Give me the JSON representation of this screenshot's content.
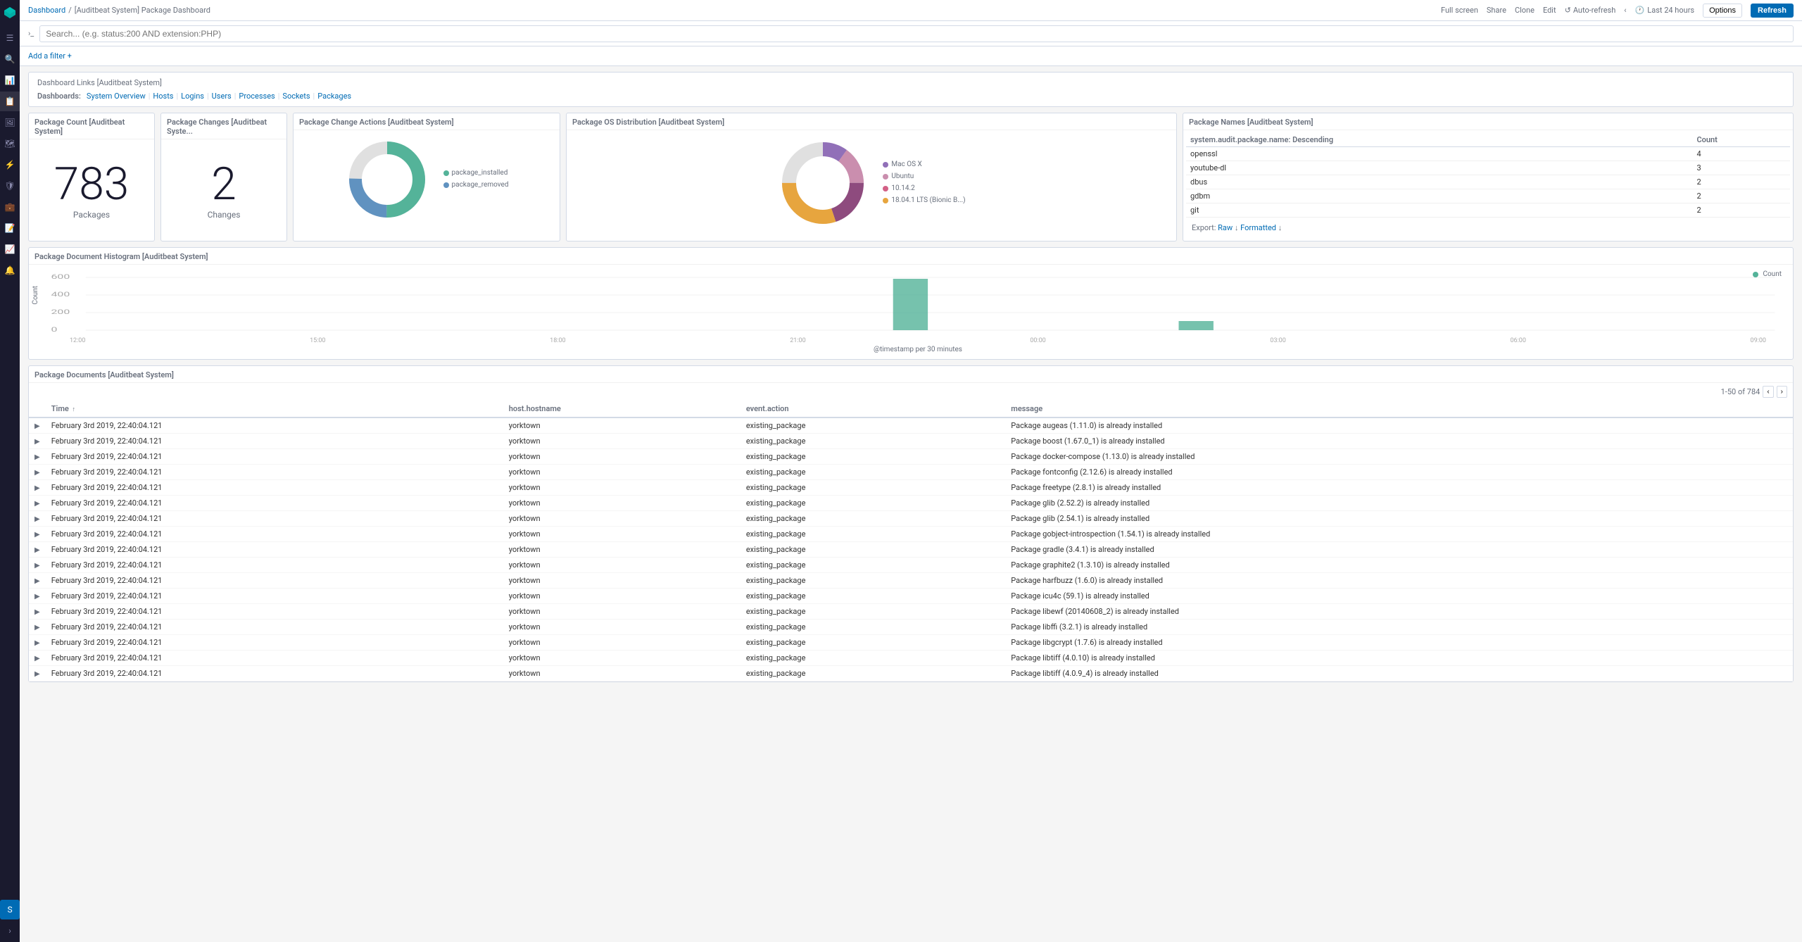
{
  "topbar": {
    "breadcrumb": [
      "Dashboard",
      "[Auditbeat System] Package Dashboard"
    ],
    "actions": {
      "full_screen": "Full screen",
      "share": "Share",
      "clone": "Clone",
      "edit": "Edit",
      "auto_refresh": "Auto-refresh",
      "time_range": "Last 24 hours",
      "options": "Options",
      "refresh": "Refresh"
    }
  },
  "search": {
    "placeholder": "Search... (e.g. status:200 AND extension:PHP)"
  },
  "filter": {
    "add": "Add a filter +"
  },
  "dashboard_links": {
    "title": "Dashboard Links [Auditbeat System]",
    "label": "Dashboards:",
    "links": [
      "System Overview",
      "Hosts",
      "Logins",
      "Users",
      "Processes",
      "Sockets",
      "Packages"
    ]
  },
  "panels": {
    "package_count": {
      "title": "Package Count [Auditbeat System]",
      "value": "783",
      "label": "Packages"
    },
    "package_changes": {
      "title": "Package Changes [Auditbeat Syste...",
      "value": "2",
      "label": "Changes"
    },
    "package_change_actions": {
      "title": "Package Change Actions [Auditbeat System]",
      "legend": [
        {
          "label": "package_installed",
          "color": "#54b399"
        },
        {
          "label": "package_removed",
          "color": "#6092c0"
        }
      ]
    },
    "package_os_distribution": {
      "title": "Package OS Distribution [Auditbeat System]",
      "legend": [
        {
          "label": "Mac OS X",
          "color": "#9170b8"
        },
        {
          "label": "Ubuntu",
          "color": "#ca8eae"
        },
        {
          "label": "10.14.2",
          "color": "#d36086"
        },
        {
          "label": "18.04.1 LTS (Bionic B...)",
          "color": "#e7a53e"
        }
      ]
    },
    "package_names": {
      "title": "Package Names [Auditbeat System]",
      "col_name": "system.audit.package.name: Descending",
      "col_count": "Count",
      "rows": [
        {
          "name": "openssl",
          "count": "4"
        },
        {
          "name": "youtube-dl",
          "count": "3"
        },
        {
          "name": "dbus",
          "count": "2"
        },
        {
          "name": "gdbm",
          "count": "2"
        },
        {
          "name": "git",
          "count": "2"
        }
      ],
      "export": {
        "label": "Export:",
        "raw": "Raw",
        "formatted": "Formatted"
      }
    },
    "histogram": {
      "title": "Package Document Histogram [Auditbeat System]",
      "x_label": "@timestamp per 30 minutes",
      "y_labels": [
        "600",
        "400",
        "200",
        "0"
      ],
      "x_ticks": [
        "12:00",
        "15:00",
        "18:00",
        "21:00",
        "00:00",
        "03:00",
        "06:00",
        "09:00"
      ],
      "legend": "Count"
    },
    "documents": {
      "title": "Package Documents [Auditbeat System]",
      "pagination": "1-50 of 784",
      "columns": [
        {
          "key": "time",
          "label": "Time ↑"
        },
        {
          "key": "hostname",
          "label": "host.hostname"
        },
        {
          "key": "event_action",
          "label": "event.action"
        },
        {
          "key": "message",
          "label": "message"
        }
      ],
      "rows": [
        {
          "time": "February 3rd 2019, 22:40:04.121",
          "hostname": "yorktown",
          "event_action": "existing_package",
          "message": "Package augeas (1.11.0) is already installed"
        },
        {
          "time": "February 3rd 2019, 22:40:04.121",
          "hostname": "yorktown",
          "event_action": "existing_package",
          "message": "Package boost (1.67.0_1) is already installed"
        },
        {
          "time": "February 3rd 2019, 22:40:04.121",
          "hostname": "yorktown",
          "event_action": "existing_package",
          "message": "Package docker-compose (1.13.0) is already installed"
        },
        {
          "time": "February 3rd 2019, 22:40:04.121",
          "hostname": "yorktown",
          "event_action": "existing_package",
          "message": "Package fontconfig (2.12.6) is already installed"
        },
        {
          "time": "February 3rd 2019, 22:40:04.121",
          "hostname": "yorktown",
          "event_action": "existing_package",
          "message": "Package freetype (2.8.1) is already installed"
        },
        {
          "time": "February 3rd 2019, 22:40:04.121",
          "hostname": "yorktown",
          "event_action": "existing_package",
          "message": "Package glib (2.52.2) is already installed"
        },
        {
          "time": "February 3rd 2019, 22:40:04.121",
          "hostname": "yorktown",
          "event_action": "existing_package",
          "message": "Package glib (2.54.1) is already installed"
        },
        {
          "time": "February 3rd 2019, 22:40:04.121",
          "hostname": "yorktown",
          "event_action": "existing_package",
          "message": "Package gobject-introspection (1.54.1) is already installed"
        },
        {
          "time": "February 3rd 2019, 22:40:04.121",
          "hostname": "yorktown",
          "event_action": "existing_package",
          "message": "Package gradle (3.4.1) is already installed"
        },
        {
          "time": "February 3rd 2019, 22:40:04.121",
          "hostname": "yorktown",
          "event_action": "existing_package",
          "message": "Package graphite2 (1.3.10) is already installed"
        },
        {
          "time": "February 3rd 2019, 22:40:04.121",
          "hostname": "yorktown",
          "event_action": "existing_package",
          "message": "Package harfbuzz (1.6.0) is already installed"
        },
        {
          "time": "February 3rd 2019, 22:40:04.121",
          "hostname": "yorktown",
          "event_action": "existing_package",
          "message": "Package icu4c (59.1) is already installed"
        },
        {
          "time": "February 3rd 2019, 22:40:04.121",
          "hostname": "yorktown",
          "event_action": "existing_package",
          "message": "Package libewf (20140608_2) is already installed"
        },
        {
          "time": "February 3rd 2019, 22:40:04.121",
          "hostname": "yorktown",
          "event_action": "existing_package",
          "message": "Package libffi (3.2.1) is already installed"
        },
        {
          "time": "February 3rd 2019, 22:40:04.121",
          "hostname": "yorktown",
          "event_action": "existing_package",
          "message": "Package libgcrypt (1.7.6) is already installed"
        },
        {
          "time": "February 3rd 2019, 22:40:04.121",
          "hostname": "yorktown",
          "event_action": "existing_package",
          "message": "Package libtiff (4.0.10) is already installed"
        },
        {
          "time": "February 3rd 2019, 22:40:04.121",
          "hostname": "yorktown",
          "event_action": "existing_package",
          "message": "Package libtiff (4.0.9_4) is already installed"
        }
      ]
    }
  },
  "sidebar": {
    "icons": [
      "≡",
      "🔎",
      "☆",
      "📊",
      "🗄",
      "⚠",
      "🛡",
      "💼",
      "📈",
      "⚙",
      "🔧",
      "💡",
      "🔔",
      "⚙"
    ]
  },
  "colors": {
    "donut1_green": "#54b399",
    "donut1_blue": "#6092c0",
    "donut1_dark": "#1a1a3e",
    "donut2_purple": "#9170b8",
    "donut2_pink": "#ca8eae",
    "donut2_dark_pink": "#8e4b7e",
    "donut2_gold": "#e7a53e",
    "donut2_dark_red": "#7b2c2c",
    "accent": "#006bb4"
  }
}
